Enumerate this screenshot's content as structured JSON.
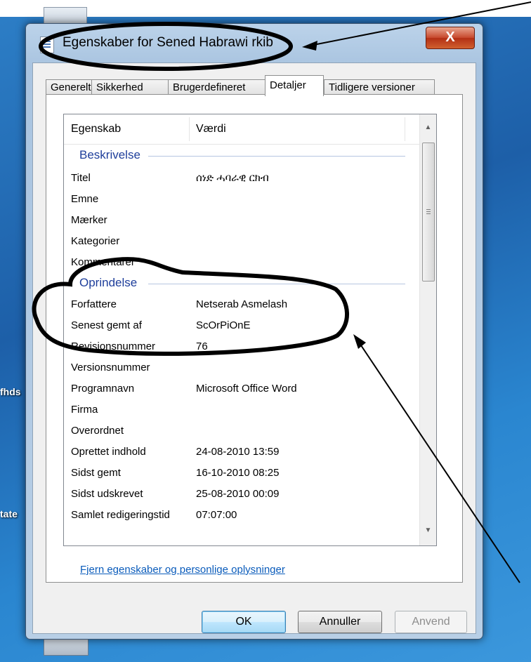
{
  "dialog": {
    "title": "Egenskaber for Sened Habrawi rkib",
    "close_label": "X",
    "tabs": [
      {
        "label": "Generelt"
      },
      {
        "label": "Sikkerhed"
      },
      {
        "label": "Brugerdefineret"
      },
      {
        "label": "Detaljer"
      },
      {
        "label": "Tidligere versioner"
      }
    ],
    "active_tab": "Detaljer"
  },
  "list": {
    "col_property": "Egenskab",
    "col_value": "Værdi",
    "groups": {
      "description": "Beskrivelse",
      "origin": "Oprindelse"
    },
    "rows": [
      {
        "prop": "Titel",
        "val": "ሰነድ ሓባራዊ ርክብ"
      },
      {
        "prop": "Emne",
        "val": ""
      },
      {
        "prop": "Mærker",
        "val": ""
      },
      {
        "prop": "Kategorier",
        "val": ""
      },
      {
        "prop": "Kommentarer",
        "val": ""
      },
      {
        "prop": "Forfattere",
        "val": "Netserab Asmelash"
      },
      {
        "prop": "Senest gemt af",
        "val": "ScOrPiOnE"
      },
      {
        "prop": "Revisionsnummer",
        "val": "76"
      },
      {
        "prop": "Versionsnummer",
        "val": ""
      },
      {
        "prop": "Programnavn",
        "val": "Microsoft Office Word"
      },
      {
        "prop": "Firma",
        "val": ""
      },
      {
        "prop": "Overordnet",
        "val": ""
      },
      {
        "prop": "Oprettet indhold",
        "val": "24-08-2010 13:59"
      },
      {
        "prop": "Sidst gemt",
        "val": "16-10-2010 08:25"
      },
      {
        "prop": "Sidst udskrevet",
        "val": "25-08-2010 00:09"
      },
      {
        "prop": "Samlet redigeringstid",
        "val": "07:07:00"
      }
    ]
  },
  "link_text": "Fjern egenskaber og personlige oplysninger",
  "buttons": {
    "ok": "OK",
    "cancel": "Annuller",
    "apply": "Anvend"
  },
  "desktop": {
    "label_1": "fhds",
    "label_2": "tate"
  }
}
